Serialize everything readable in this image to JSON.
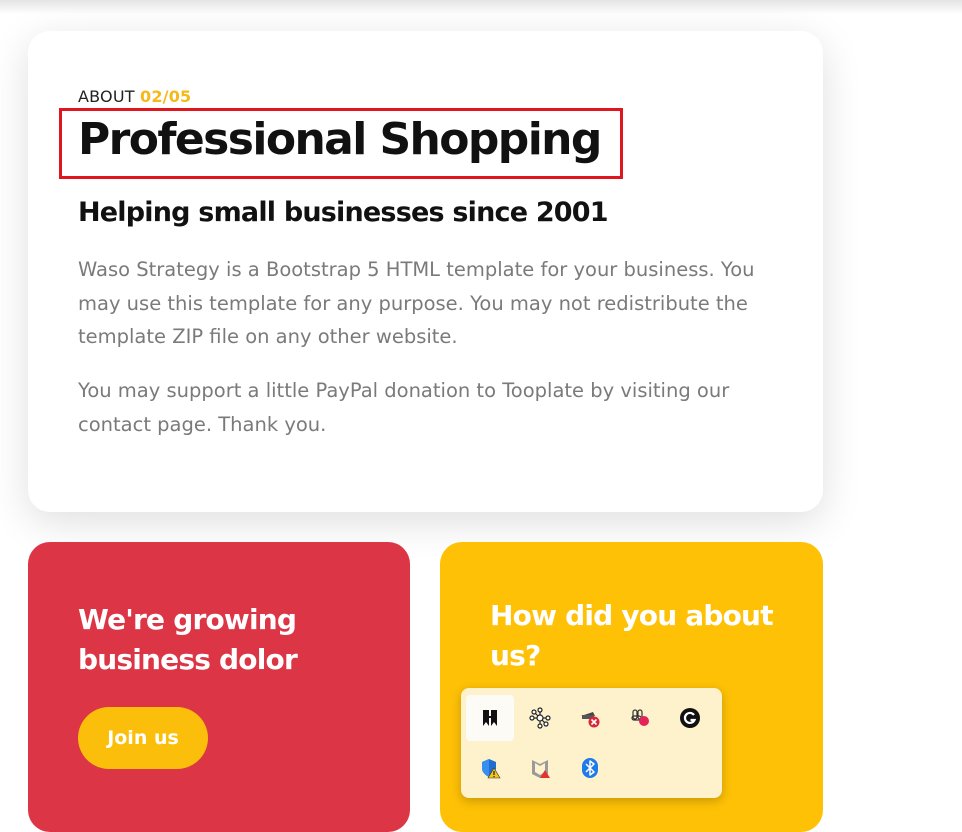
{
  "about": {
    "label": "ABOUT",
    "number": "02/05",
    "title": "Professional Shopping",
    "subtitle": "Helping small businesses since 2001",
    "paragraph1": "Waso Strategy is a Bootstrap 5 HTML template for your business. You may use this template for any purpose. You may not redistribute the template ZIP file on any other website.",
    "paragraph2": "You may support a little PayPal donation to Tooplate by visiting our contact page. Thank you."
  },
  "growing": {
    "title": "We're growing business dolor",
    "button_label": "Join us"
  },
  "how": {
    "title": "How did you about us?"
  },
  "tray": {
    "icons": [
      "bookmark-app-icon",
      "network-nodes-icon",
      "disconnected-app-icon",
      "slack-icon",
      "grammarly-icon",
      "security-warning-icon",
      "mcafee-icon",
      "bluetooth-icon"
    ]
  },
  "colors": {
    "accent_yellow": "#fec106",
    "accent_red": "#dc3545",
    "highlight_border": "#e0161e",
    "number_color": "#f6b91c"
  }
}
